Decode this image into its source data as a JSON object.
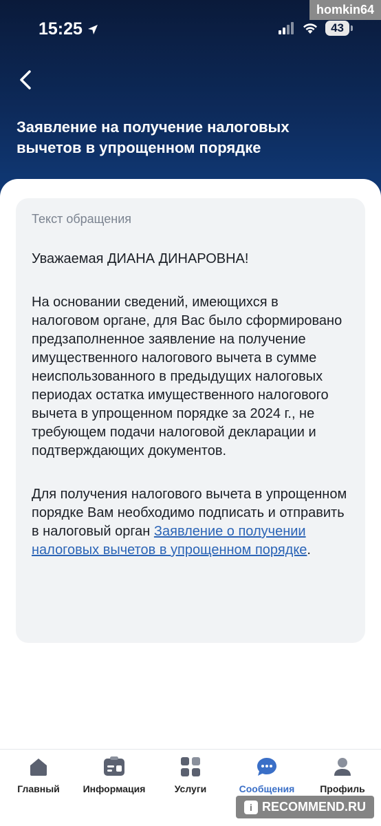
{
  "status_bar": {
    "time": "15:25",
    "battery": "43",
    "watermark": "homkin64"
  },
  "header": {
    "title": "Заявление на получение налоговых вычетов в упрощенном порядке"
  },
  "message": {
    "label": "Текст обращения",
    "greeting": "Уважаемая ДИАНА ДИНАРОВНА!",
    "paragraph1": "На основании сведений, имеющихся в налоговом органе, для Вас было сформировано предзаполненное заявление на получение имущественного налогового вычета в сумме неиспользованного в предыдущих налоговых периодах остатка имущественного налогового вычета в упрощенном порядке за 2024 г., не требующем подачи налоговой декларации и подтверждающих документов.",
    "paragraph2_prefix": "Для получения налогового вычета в упрощенном порядке Вам необходимо подписать и отправить в налоговый орган ",
    "paragraph2_link": "Заявление о получении налоговых вычетов в упрощенном порядке",
    "paragraph2_suffix": "."
  },
  "tab_bar": {
    "tabs": [
      {
        "label": "Главный",
        "icon": "home-icon"
      },
      {
        "label": "Информация",
        "icon": "info-card-icon"
      },
      {
        "label": "Услуги",
        "icon": "grid-icon"
      },
      {
        "label": "Сообщения",
        "icon": "chat-icon",
        "active": true
      },
      {
        "label": "Профиль",
        "icon": "profile-icon"
      }
    ]
  },
  "watermark_bottom": "RECOMMEND.RU",
  "colors": {
    "header_dark": "#0a1a3a",
    "accent": "#3a6fc7",
    "link": "#2b64b6",
    "card_bg": "#f1f3f5"
  }
}
